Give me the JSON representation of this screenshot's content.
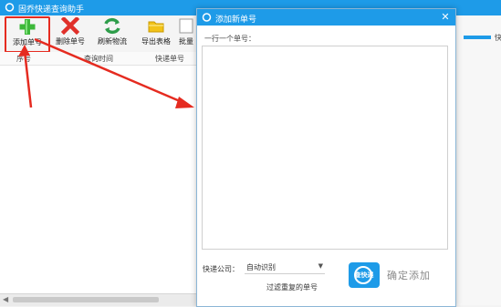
{
  "main_window": {
    "title": "固乔快递查询助手"
  },
  "toolbar": {
    "add_label": "添加单号",
    "delete_label": "删除单号",
    "refresh_label": "刷新物流",
    "export_label": "导出表格",
    "batch_label": "批量"
  },
  "table": {
    "columns": [
      "序号",
      "查询时间",
      "快递单号"
    ]
  },
  "right_strip": {
    "text": "快"
  },
  "dialog": {
    "title": "添加新单号",
    "instruction": "一行一个单号：",
    "textarea_value": "",
    "company_label": "快递公司：",
    "company_value": "自动识别",
    "filter_label": "过滤重复的单号",
    "logo_text": "查快递",
    "confirm_label": "确定添加"
  },
  "colors": {
    "accent": "#1e9be8",
    "annotation": "#e52b20"
  },
  "icons": {
    "add": "green-plus-icon",
    "delete": "red-x-icon",
    "refresh": "green-refresh-icon",
    "export": "yellow-folder-icon",
    "close": "close-icon",
    "select": "chevron-down-icon"
  }
}
